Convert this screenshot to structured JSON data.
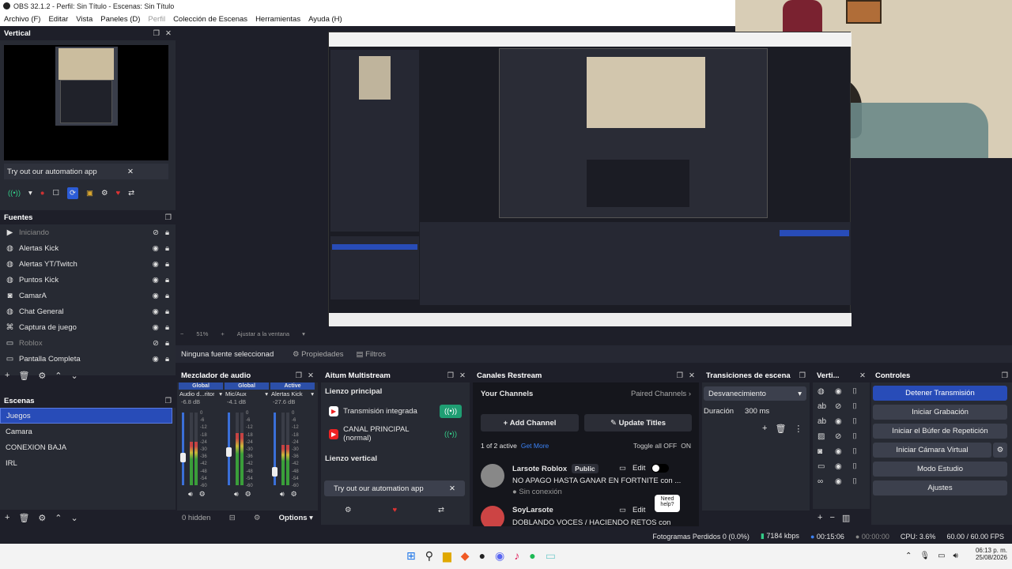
{
  "window_title": "OBS 32.1.2 - Perfil: Sin Título - Escenas: Sin Título",
  "menu": [
    "Archivo (F)",
    "Editar",
    "Vista",
    "Paneles (D)",
    "Perfil",
    "Colección de Escenas",
    "Herramientas",
    "Ayuda (H)"
  ],
  "vertical": {
    "title": "Vertical",
    "automation": "Try out our automation app"
  },
  "sources": {
    "title": "Fuentes",
    "items": [
      {
        "label": "Iniciando",
        "icon": "play-icon",
        "hidden": true
      },
      {
        "label": "Alertas Kick",
        "icon": "globe-icon"
      },
      {
        "label": "Alertas YT/Twitch",
        "icon": "globe-icon"
      },
      {
        "label": "Puntos Kick",
        "icon": "globe-icon"
      },
      {
        "label": "CamarA",
        "icon": "camera-icon"
      },
      {
        "label": "Chat General",
        "icon": "globe-icon"
      },
      {
        "label": "Captura de juego",
        "icon": "gamepad-icon"
      },
      {
        "label": "Roblox",
        "icon": "window-icon",
        "hidden": true
      },
      {
        "label": "Pantalla Completa",
        "icon": "monitor-icon"
      }
    ]
  },
  "scenes": {
    "title": "Escenas",
    "items": [
      "Juegos",
      "Camara",
      "CONEXION BAJA",
      "IRL"
    ],
    "selected": 0
  },
  "preview_bar": {
    "zoom": "51%",
    "fit": "Ajustar a la ventana"
  },
  "context_bar": {
    "none": "Ninguna fuente seleccionad",
    "props": "Propiedades",
    "filters": "Filtros"
  },
  "mixer": {
    "title": "Mezclador de audio",
    "tracks": [
      {
        "tag": "Global",
        "name": "Audio d...ritorio",
        "db": "-6.8 dB",
        "level": 0.6,
        "fader": 0.45
      },
      {
        "tag": "Global",
        "name": "Mic/Aux",
        "db": "-4.1 dB",
        "level": 0.72,
        "fader": 0.52
      },
      {
        "tag": "Active",
        "name": "Alertas Kick",
        "db": "-27.6 dB",
        "level": 0.55,
        "fader": 0.25
      }
    ],
    "scale": [
      "0",
      "-6",
      "-12",
      "-18",
      "-24",
      "-30",
      "-36",
      "-42",
      "-48",
      "-54",
      "-60"
    ],
    "hidden": "0 hidden",
    "options": "Options"
  },
  "aitum": {
    "title": "Aitum Multistream",
    "section": "Lienzo principal",
    "outputs": [
      "Transmisión integrada",
      "CANAL PRINCIPAL (normal)"
    ],
    "section2": "Lienzo vertical",
    "automation": "Try out our automation app"
  },
  "restream": {
    "title": "Canales Restream",
    "your": "Your Channels",
    "paired": "Paired Channels",
    "add": "Add Channel",
    "update": "Update Titles",
    "active": "1 of 2 active",
    "getmore": "Get More",
    "toggle": "Toggle all OFF",
    "on": "ON",
    "channels": [
      {
        "name": "Larsote Roblox",
        "badge": "Public",
        "edit": "Edit",
        "title": "NO APAGO HASTA GANAR EN FORTNITE con ...",
        "status": "Sin conexión"
      },
      {
        "name": "SoyLarsote",
        "edit": "Edit",
        "title": "DOBLANDO VOCES / HACIENDO RETOS con ...",
        "help": "Need help?"
      }
    ]
  },
  "transitions": {
    "title": "Transiciones de escena",
    "type": "Desvanecimiento",
    "duration_label": "Duración",
    "duration": "300 ms"
  },
  "verti": {
    "title": "Verti..."
  },
  "controls": {
    "title": "Controles",
    "buttons": [
      "Detener Transmisión",
      "Iniciar Grabación",
      "Iniciar el Búfer de Repetición",
      "Iniciar Cámara Virtual",
      "Modo Estudio",
      "Ajustes"
    ]
  },
  "status": {
    "dropped": "Fotogramas Perdidos 0 (0.0%)",
    "kbps": "7184 kbps",
    "live": "00:15:06",
    "rec": "00:00:00",
    "cpu": "CPU: 3.6%",
    "fps": "60.00 / 60.00 FPS"
  },
  "taskbar": {
    "time": "06:13 p. m.",
    "date": "25/08/2026"
  },
  "colors": {
    "accent": "#284cb8",
    "bg": "#1e1f29",
    "panel": "#272a33"
  }
}
